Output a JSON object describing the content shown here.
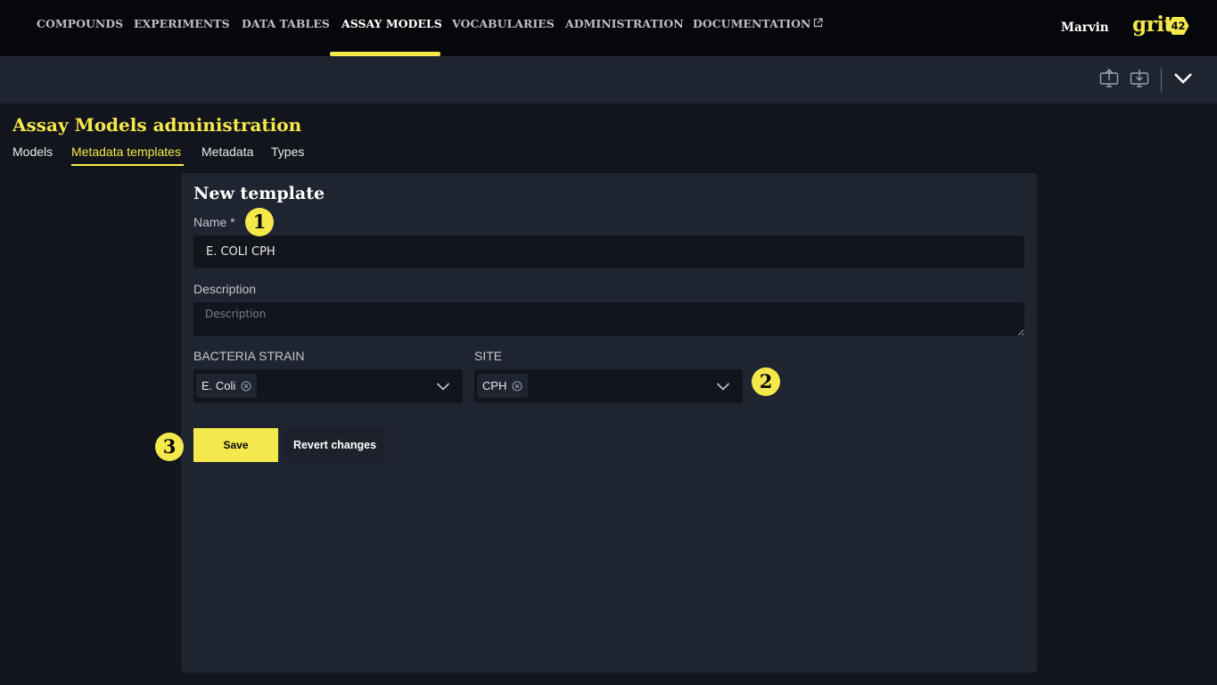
{
  "nav": {
    "items": [
      {
        "label": "COMPOUNDS"
      },
      {
        "label": "EXPERIMENTS"
      },
      {
        "label": "DATA TABLES"
      },
      {
        "label": "ASSAY MODELS",
        "active": true
      },
      {
        "label": "VOCABULARIES"
      },
      {
        "label": "ADMINISTRATION"
      },
      {
        "label": "DOCUMENTATION",
        "icon": "external-link-icon"
      }
    ],
    "user": "Marvin",
    "logo": {
      "text": "grit",
      "badge": "42"
    }
  },
  "toolbar": {
    "icons": [
      "upload-icon",
      "download-icon",
      "chevron-down-icon"
    ]
  },
  "page": {
    "title": "Assay Models administration",
    "tabs": [
      {
        "label": "Models"
      },
      {
        "label": "Metadata templates",
        "active": true
      },
      {
        "label": "Metadata"
      },
      {
        "label": "Types"
      }
    ]
  },
  "form": {
    "title": "New template",
    "name": {
      "label": "Name *",
      "value": "E. COLI CPH"
    },
    "description": {
      "label": "Description",
      "placeholder": "Description",
      "value": ""
    },
    "bacteria_strain": {
      "label": "BACTERIA STRAIN",
      "selected": "E. Coli"
    },
    "site": {
      "label": "SITE",
      "selected": "CPH"
    },
    "save_label": "Save",
    "revert_label": "Revert changes"
  },
  "annotations": [
    "1",
    "2",
    "3"
  ],
  "colors": {
    "accent": "#f5e84c",
    "nav_bg": "#05070b",
    "toolbar_bg": "#1f2530",
    "page_bg": "#12151c",
    "card_bg": "#1f2530"
  }
}
